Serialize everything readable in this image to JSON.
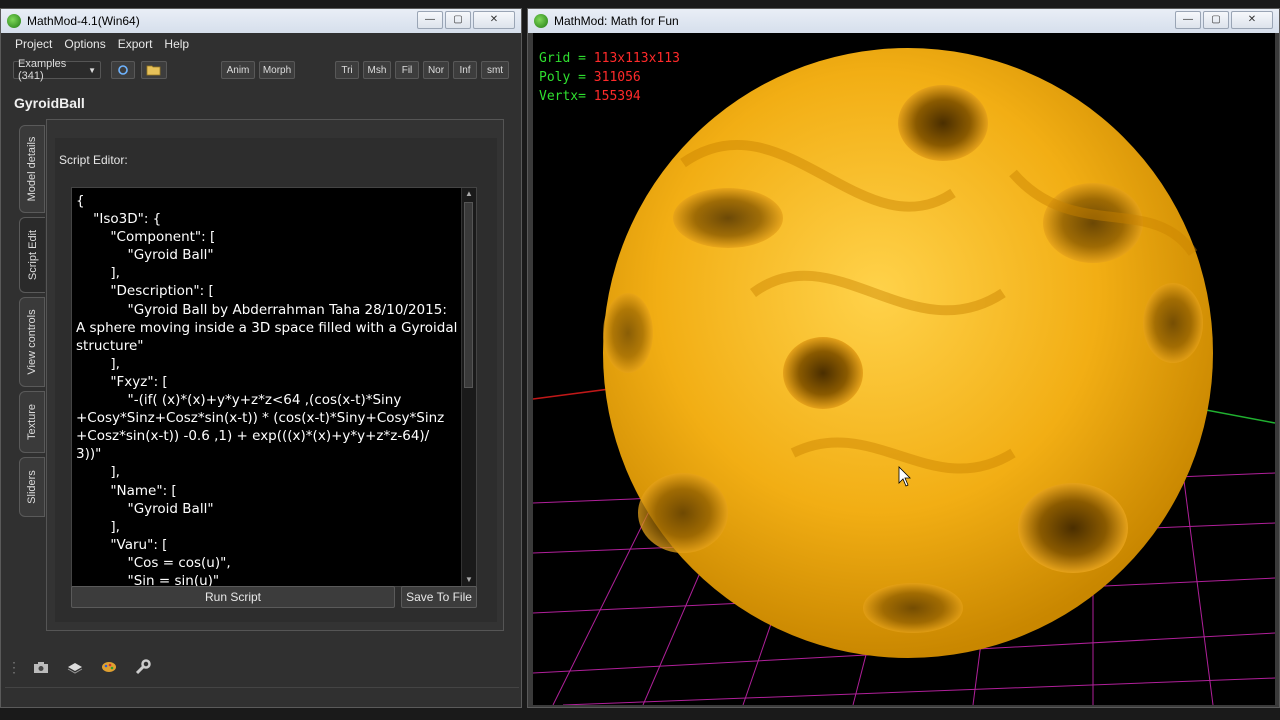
{
  "left_window": {
    "title": "MathMod-4.1(Win64)",
    "menu": [
      "Project",
      "Options",
      "Export",
      "Help"
    ],
    "examples_combo": "Examples (341)",
    "toolbar_buttons": [
      "Anim",
      "Morph",
      "Tri",
      "Msh",
      "Fil",
      "Nor",
      "Inf",
      "smt"
    ],
    "model_name": "GyroidBall",
    "side_tabs": [
      "Model details",
      "Script Edit",
      "View controls",
      "Texture",
      "Sliders"
    ],
    "editor_label": "Script Editor:",
    "script_text": "{\n    \"Iso3D\": {\n        \"Component\": [\n            \"Gyroid Ball\"\n        ],\n        \"Description\": [\n            \"Gyroid Ball by Abderrahman Taha 28/10/2015:\nA sphere moving inside a 3D space filled with a Gyroidal\nstructure\"\n        ],\n        \"Fxyz\": [\n            \"-(if( (x)*(x)+y*y+z*z<64 ,(cos(x-t)*Siny\n+Cosy*Sinz+Cosz*sin(x-t)) * (cos(x-t)*Siny+Cosy*Sinz\n+Cosz*sin(x-t)) -0.6 ,1) + exp(((x)*(x)+y*y+z*z-64)/\n3))\"\n        ],\n        \"Name\": [\n            \"Gyroid Ball\"\n        ],\n        \"Varu\": [\n            \"Cos = cos(u)\",\n            \"Sin = sin(u)\"",
    "run_button": "Run Script",
    "save_button": "Save To File"
  },
  "right_window": {
    "title": "MathMod: Math for Fun",
    "stats": [
      {
        "label": "Grid  =",
        "value": "113x113x113"
      },
      {
        "label": "Poly  =",
        "value": "311056"
      },
      {
        "label": "Vertx=",
        "value": "155394"
      }
    ]
  },
  "colors": {
    "surface": "#f2b21a",
    "grid": "#b0209a",
    "stats_label": "#2fe02f",
    "stats_value": "#ff2a2a"
  }
}
